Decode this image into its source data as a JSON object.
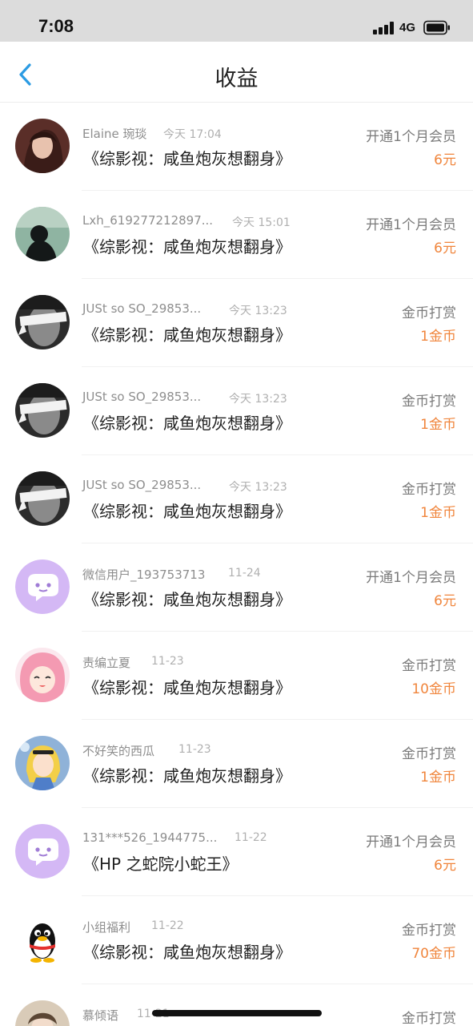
{
  "status_bar": {
    "time": "7:08",
    "network": "4G"
  },
  "nav": {
    "title": "收益"
  },
  "records": [
    {
      "user": "Elaine 琬琰",
      "time": "今天 17:04",
      "book": "《综影视：咸鱼炮灰想翻身》",
      "type": "开通1个月会员",
      "amount": "6元",
      "avatar": "girl-portrait"
    },
    {
      "user": "Lxh_619277212897...",
      "time": "今天 15:01",
      "book": "《综影视：咸鱼炮灰想翻身》",
      "type": "开通1个月会员",
      "amount": "6元",
      "avatar": "silhouette-girl"
    },
    {
      "user": "JUSt so SO_29853...",
      "time": "今天 13:23",
      "book": "《综影视：咸鱼炮灰想翻身》",
      "type": "金币打赏",
      "amount": "1金币",
      "avatar": "blindfold-man"
    },
    {
      "user": "JUSt so SO_29853...",
      "time": "今天 13:23",
      "book": "《综影视：咸鱼炮灰想翻身》",
      "type": "金币打赏",
      "amount": "1金币",
      "avatar": "blindfold-man"
    },
    {
      "user": "JUSt so SO_29853...",
      "time": "今天 13:23",
      "book": "《综影视：咸鱼炮灰想翻身》",
      "type": "金币打赏",
      "amount": "1金币",
      "avatar": "blindfold-man"
    },
    {
      "user": "微信用户_193753713",
      "time": "11-24",
      "book": "《综影视：咸鱼炮灰想翻身》",
      "type": "开通1个月会员",
      "amount": "6元",
      "avatar": "chat-bubble"
    },
    {
      "user": "责编立夏",
      "time": "11-23",
      "book": "《综影视：咸鱼炮灰想翻身》",
      "type": "金币打赏",
      "amount": "10金币",
      "avatar": "anime-pink-girl"
    },
    {
      "user": "不好笑的西瓜",
      "time": "11-23",
      "book": "《综影视：咸鱼炮灰想翻身》",
      "type": "金币打赏",
      "amount": "1金币",
      "avatar": "alice-cartoon"
    },
    {
      "user": "131***526_1944775...",
      "time": "11-22",
      "book": "《HP 之蛇院小蛇王》",
      "type": "开通1个月会员",
      "amount": "6元",
      "avatar": "chat-bubble"
    },
    {
      "user": "小组福利",
      "time": "11-22",
      "book": "《综影视：咸鱼炮灰想翻身》",
      "type": "金币打赏",
      "amount": "70金币",
      "avatar": "qq-penguin"
    },
    {
      "user": "慕倾语",
      "time": "11-21",
      "book": "",
      "type": "金币打赏",
      "amount": "",
      "avatar": "portrait"
    }
  ],
  "colors": {
    "accent": "#2b9be3",
    "amount": "#f0853c",
    "bubble": "#d4b8f5"
  }
}
